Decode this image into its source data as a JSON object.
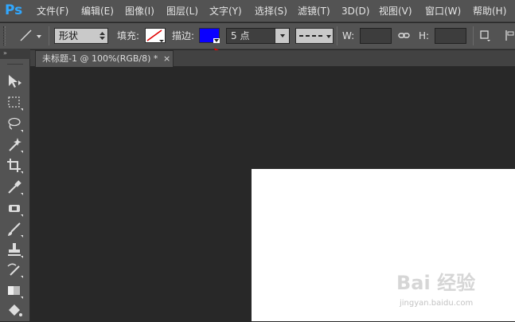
{
  "app": {
    "logo": "Ps"
  },
  "menu": [
    "文件(F)",
    "编辑(E)",
    "图像(I)",
    "图层(L)",
    "文字(Y)",
    "选择(S)",
    "滤镜(T)",
    "3D(D)",
    "视图(V)",
    "窗口(W)",
    "帮助(H)"
  ],
  "options": {
    "mode": "形状",
    "fill_label": "填充:",
    "stroke_label": "描边:",
    "stroke_color": "#0a00ff",
    "stroke_width": "5 点",
    "w_label": "W:",
    "h_label": "H:"
  },
  "document": {
    "tab_title": "未标题-1 @ 100%(RGB/8) *",
    "close": "×"
  },
  "tools": [
    "move-icon",
    "marquee-icon",
    "lasso-icon",
    "magic-wand-icon",
    "crop-icon",
    "eyedropper-icon",
    "healing-brush-icon",
    "brush-icon",
    "clone-stamp-icon",
    "history-brush-icon",
    "paint-bucket-icon"
  ],
  "watermark": {
    "brand": "Bai 经验",
    "url": "jingyan.baidu.com"
  },
  "colors": {
    "canvas": "#ffffff",
    "workspace": "#282828",
    "panel": "#535353"
  }
}
